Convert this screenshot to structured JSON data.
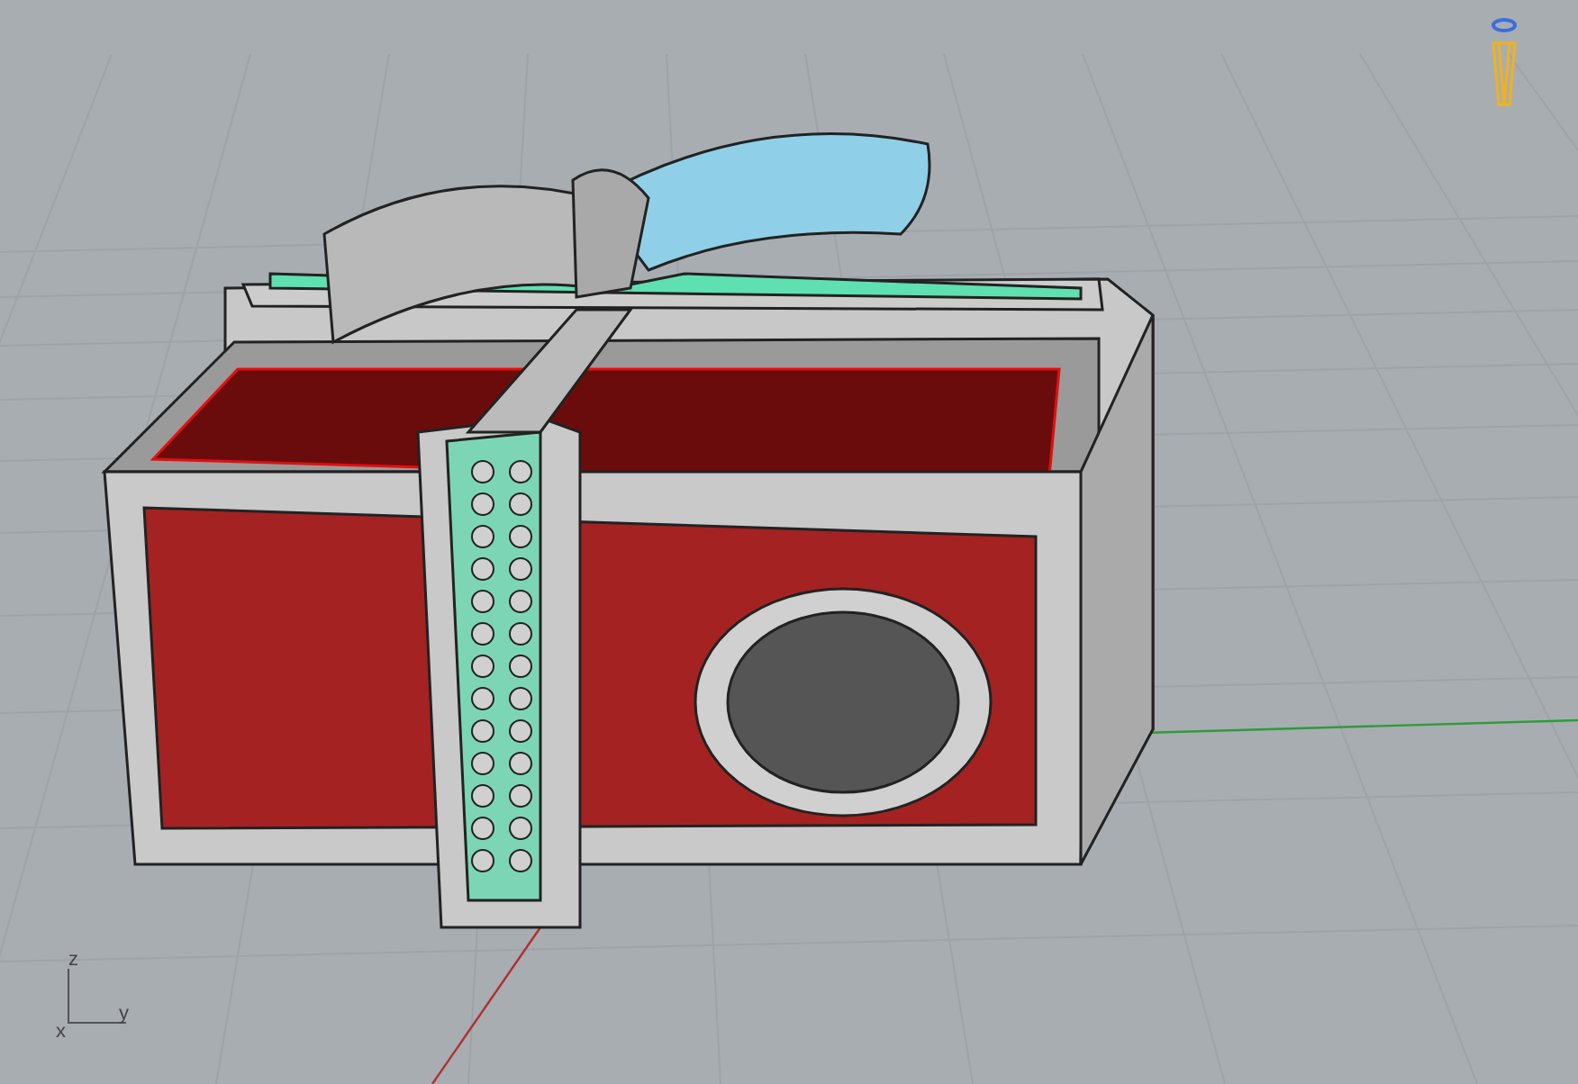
{
  "viewport": {
    "axis_labels": [
      {
        "label": "z"
      },
      {
        "label": "x"
      },
      {
        "label": "y"
      }
    ]
  }
}
